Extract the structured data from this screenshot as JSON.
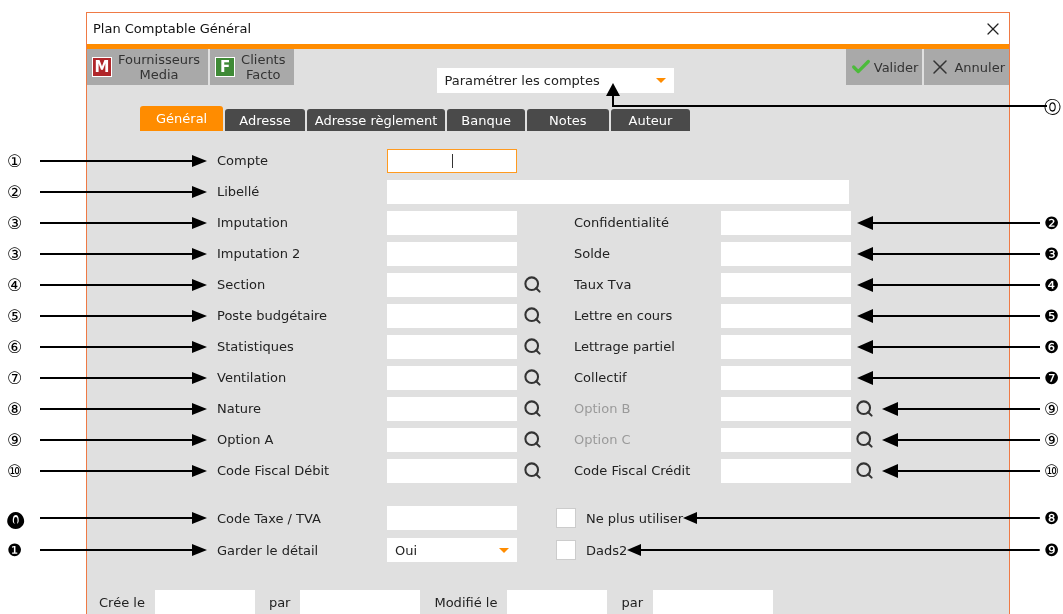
{
  "window": {
    "title": "Plan Comptable Général"
  },
  "shortcuts": [
    {
      "letter": "M",
      "label": "Fournisseurs\nMedia",
      "color": "#b0262a"
    },
    {
      "letter": "F",
      "label": "Clients\nFacto",
      "color": "#3f8a36"
    }
  ],
  "mode_select": {
    "value": "Paramétrer les comptes",
    "marker": "⓪"
  },
  "actions": [
    {
      "kind": "confirm",
      "label": "Valider"
    },
    {
      "kind": "cancel",
      "label": "Annuler"
    }
  ],
  "tabs": [
    {
      "label": "Général",
      "selected": true
    },
    {
      "label": "Adresse",
      "selected": false
    },
    {
      "label": "Adresse règlement",
      "selected": false
    },
    {
      "label": "Banque",
      "selected": false
    },
    {
      "label": "Notes",
      "selected": false
    },
    {
      "label": "Auteur",
      "selected": false
    }
  ],
  "rows": [
    {
      "left": {
        "label": "Compte",
        "focused": true,
        "marker": "①"
      }
    },
    {
      "left": {
        "label": "Libellé",
        "wide": true,
        "marker": "②"
      }
    },
    {
      "left": {
        "label": "Imputation",
        "marker": "③"
      },
      "right": {
        "label": "Confidentialité",
        "disabled": false,
        "marker": "❷"
      }
    },
    {
      "left": {
        "label": "Imputation 2",
        "marker": "③"
      },
      "right": {
        "label": "Solde",
        "disabled": false,
        "marker": "❸"
      }
    },
    {
      "left": {
        "label": "Section",
        "lookup": true,
        "marker": "④"
      },
      "right": {
        "label": "Taux Tva",
        "disabled": false,
        "marker": "❹"
      }
    },
    {
      "left": {
        "label": "Poste budgétaire",
        "lookup": true,
        "marker": "⑤"
      },
      "right": {
        "label": "Lettre en cours",
        "disabled": false,
        "marker": "❺"
      }
    },
    {
      "left": {
        "label": "Statistiques",
        "lookup": true,
        "marker": "⑥"
      },
      "right": {
        "label": "Lettrage partiel",
        "disabled": false,
        "marker": "❻"
      }
    },
    {
      "left": {
        "label": "Ventilation",
        "lookup": true,
        "marker": "⑦"
      },
      "right": {
        "label": "Collectif",
        "disabled": false,
        "marker": "❼"
      }
    },
    {
      "left": {
        "label": "Nature",
        "lookup": true,
        "marker": "⑧"
      },
      "right": {
        "label": "Option B",
        "disabled": true,
        "lookup": true,
        "marker": "⑨"
      }
    },
    {
      "left": {
        "label": "Option A",
        "lookup": true,
        "marker": "⑨"
      },
      "right": {
        "label": "Option C",
        "disabled": true,
        "lookup": true,
        "marker": "⑨"
      }
    },
    {
      "left": {
        "label": "Code Fiscal Débit",
        "lookup": true,
        "marker": "⑩"
      },
      "right": {
        "label": "Code Fiscal Crédit",
        "disabled": false,
        "lookup": true,
        "marker": "⑩"
      }
    }
  ],
  "options": [
    {
      "kind": "text",
      "label": "Code Taxe / TVA",
      "marker": "⓿",
      "check": {
        "label": "Ne plus utiliser",
        "checked": false,
        "marker": "❽"
      }
    },
    {
      "kind": "select",
      "label": "Garder le détail",
      "value": "Oui",
      "marker": "❶",
      "check": {
        "label": "Dads2",
        "checked": false,
        "marker": "❾"
      }
    }
  ],
  "footer": [
    {
      "label": "Crée le"
    },
    {
      "label": "par"
    },
    {
      "label": "Modifié le"
    },
    {
      "label": "par"
    }
  ]
}
